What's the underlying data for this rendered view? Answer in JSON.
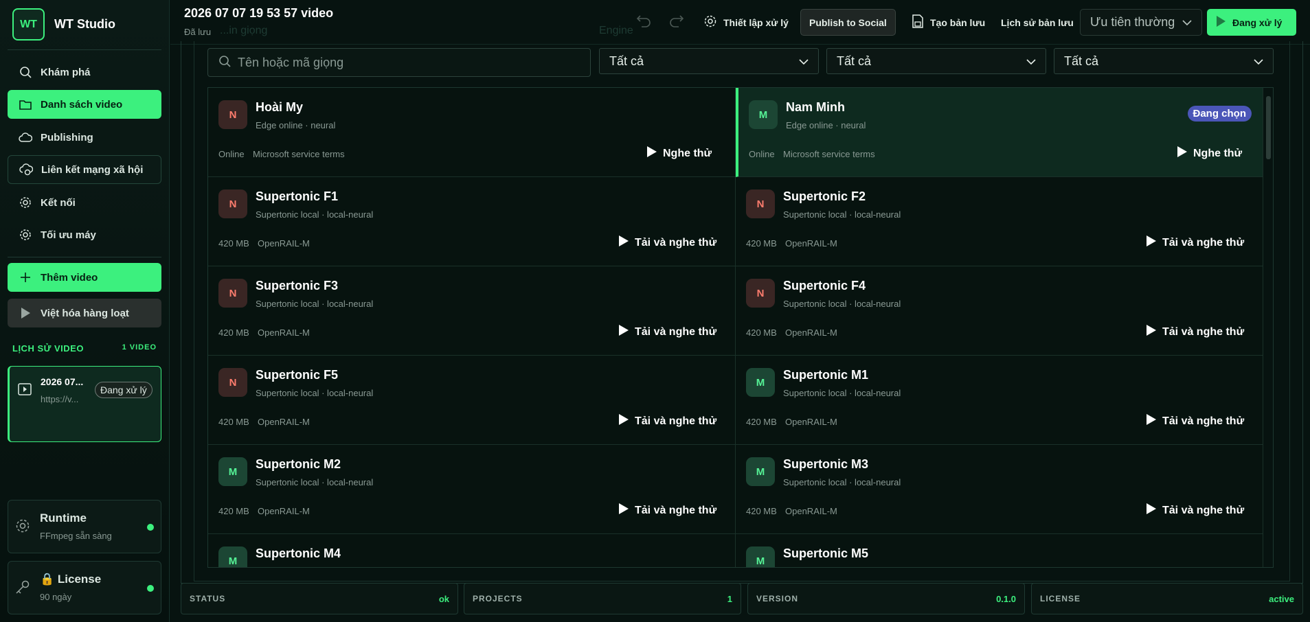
{
  "brand": {
    "logo": "WT",
    "name": "WT Studio"
  },
  "nav": [
    {
      "label": "Khám phá",
      "icon": "search-icon"
    },
    {
      "label": "Danh sách video",
      "icon": "folder-icon"
    },
    {
      "label": "Publishing",
      "icon": "cloud-icon"
    },
    {
      "label": "Liên kết mạng xã hội",
      "icon": "cloud-link-icon"
    },
    {
      "label": "Kết nối",
      "icon": "gear-icon"
    },
    {
      "label": "Tối ưu máy",
      "icon": "gear-icon"
    }
  ],
  "actions": {
    "add_video": "Thêm video",
    "batch": "Việt hóa hàng loạt"
  },
  "history": {
    "title": "LỊCH SỬ VIDEO",
    "count": "1 VIDEO",
    "item": {
      "title": "2026 07...",
      "url": "https://v...",
      "badge": "Đang xử lý"
    }
  },
  "runtime": {
    "title": "Runtime",
    "subtitle": "FFmpeg sẵn sàng"
  },
  "license_card": {
    "title": "🔒 License",
    "subtitle": "90 ngày"
  },
  "topbar": {
    "title": "2026 07 07 19 53 57 video",
    "status": "Đã lưu",
    "ghost_left": "...in giọng",
    "ghost_engine": "Engine",
    "settings_label": "Thiết lập xử lý",
    "publish_label": "Publish to Social",
    "backup_label": "Tạo bản lưu",
    "history_label": "Lịch sử bản lưu",
    "priority_value": "Ưu tiên thường",
    "run_label": "Đang xử lý"
  },
  "search": {
    "placeholder": "Tên hoặc mã giọng"
  },
  "filters": [
    "Tất cả",
    "Tất cả",
    "Tất cả"
  ],
  "voices": [
    {
      "initial": "N",
      "name": "Hoài My",
      "sub": "Edge online · neural",
      "meta1": "Online",
      "meta2": "Microsoft service terms",
      "action": "Nghe thử",
      "selected": false
    },
    {
      "initial": "M",
      "name": "Nam Minh",
      "sub": "Edge online · neural",
      "meta1": "Online",
      "meta2": "Microsoft service terms",
      "action": "Nghe thử",
      "selected": true,
      "badge": "Đang chọn"
    },
    {
      "initial": "N",
      "name": "Supertonic F1",
      "sub": "Supertonic local · local-neural",
      "meta1": "420 MB",
      "meta2": "OpenRAIL-M",
      "action": "Tải và nghe thử"
    },
    {
      "initial": "N",
      "name": "Supertonic F2",
      "sub": "Supertonic local · local-neural",
      "meta1": "420 MB",
      "meta2": "OpenRAIL-M",
      "action": "Tải và nghe thử"
    },
    {
      "initial": "N",
      "name": "Supertonic F3",
      "sub": "Supertonic local · local-neural",
      "meta1": "420 MB",
      "meta2": "OpenRAIL-M",
      "action": "Tải và nghe thử"
    },
    {
      "initial": "N",
      "name": "Supertonic F4",
      "sub": "Supertonic local · local-neural",
      "meta1": "420 MB",
      "meta2": "OpenRAIL-M",
      "action": "Tải và nghe thử"
    },
    {
      "initial": "N",
      "name": "Supertonic F5",
      "sub": "Supertonic local · local-neural",
      "meta1": "420 MB",
      "meta2": "OpenRAIL-M",
      "action": "Tải và nghe thử"
    },
    {
      "initial": "M",
      "name": "Supertonic M1",
      "sub": "Supertonic local · local-neural",
      "meta1": "420 MB",
      "meta2": "OpenRAIL-M",
      "action": "Tải và nghe thử"
    },
    {
      "initial": "M",
      "name": "Supertonic M2",
      "sub": "Supertonic local · local-neural",
      "meta1": "420 MB",
      "meta2": "OpenRAIL-M",
      "action": "Tải và nghe thử"
    },
    {
      "initial": "M",
      "name": "Supertonic M3",
      "sub": "Supertonic local · local-neural",
      "meta1": "420 MB",
      "meta2": "OpenRAIL-M",
      "action": "Tải và nghe thử"
    },
    {
      "initial": "M",
      "name": "Supertonic M4",
      "sub": "",
      "meta1": "",
      "meta2": "",
      "action": ""
    },
    {
      "initial": "M",
      "name": "Supertonic M5",
      "sub": "",
      "meta1": "",
      "meta2": "",
      "action": ""
    }
  ],
  "statusbar": [
    {
      "key": "STATUS",
      "value": "ok"
    },
    {
      "key": "PROJECTS",
      "value": "1"
    },
    {
      "key": "VERSION",
      "value": "0.1.0"
    },
    {
      "key": "LICENSE",
      "value": "active"
    }
  ],
  "colors": {
    "accent": "#3cf07e",
    "background": "#071310",
    "badge": "#4b56b8",
    "n_avatar": "#ff7d6e",
    "m_avatar": "#56f296"
  }
}
